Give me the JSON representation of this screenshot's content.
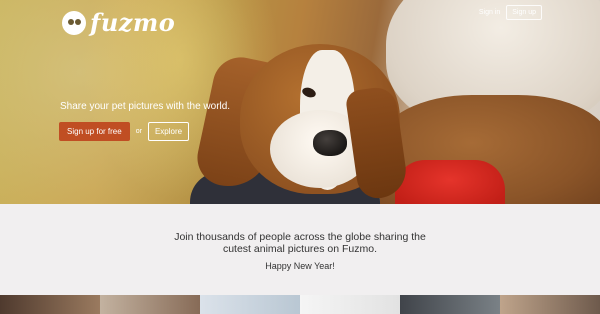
{
  "brand": {
    "name": "fuzmo",
    "logo_icon": "paw-face-icon"
  },
  "nav": {
    "signin_label": "Sign in",
    "signup_label": "Sign up"
  },
  "hero": {
    "tagline": "Share your pet pictures with the world.",
    "cta_primary": "Sign up for free",
    "cta_or": "or",
    "cta_secondary": "Explore",
    "primary_color": "#c04e23"
  },
  "intro": {
    "line1": "Join thousands of people across the globe sharing the",
    "line2": "cutest animal pictures on Fuzmo.",
    "greeting": "Happy New Year!"
  }
}
